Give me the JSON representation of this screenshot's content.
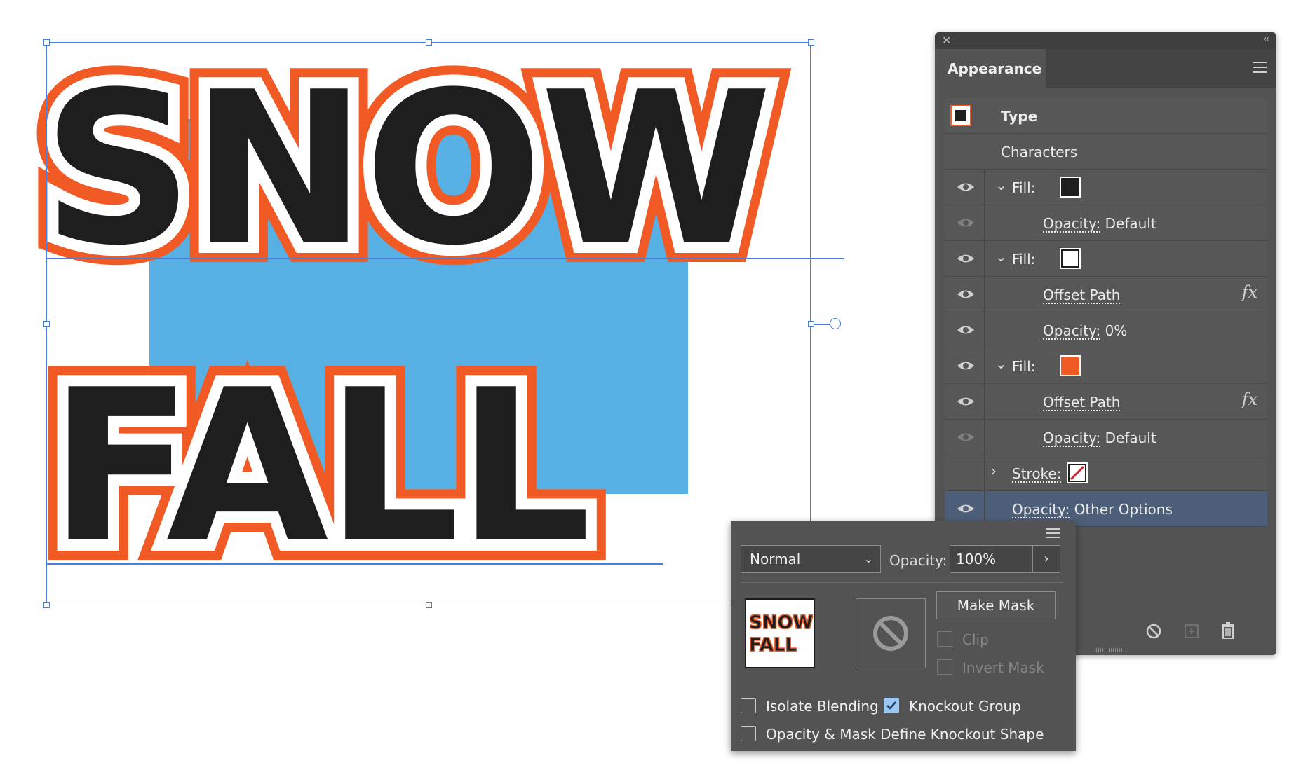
{
  "artwork": {
    "line1": "SNOW",
    "line2": "FALL",
    "colors": {
      "text": "#1e1e1e",
      "outer_stroke": "#f15a25",
      "inner_offset": "#ffffff",
      "background_rect": "#56b0e3",
      "selection": "#4a7fd8"
    }
  },
  "appearance_panel": {
    "tab_title": "Appearance",
    "rows": [
      {
        "label": "Type",
        "kind": "header",
        "swatch": "type"
      },
      {
        "label": "Characters",
        "kind": "plain"
      },
      {
        "label": "Fill:",
        "kind": "fill",
        "expanded": true,
        "swatch_color": "#1e1e1e",
        "eye": true
      },
      {
        "label": "Opacity:",
        "value": "Default",
        "kind": "sub",
        "eye": "dim"
      },
      {
        "label": "Fill:",
        "kind": "fill",
        "expanded": true,
        "swatch_color": "#ffffff",
        "eye": true
      },
      {
        "label": "Offset Path",
        "kind": "effect",
        "eye": true,
        "fx": "fx"
      },
      {
        "label": "Opacity:",
        "value": "0%",
        "kind": "sub",
        "eye": true
      },
      {
        "label": "Fill:",
        "kind": "fill",
        "expanded": true,
        "swatch_color": "#f15a25",
        "eye": true
      },
      {
        "label": "Offset Path",
        "kind": "effect",
        "eye": true,
        "fx": "fx"
      },
      {
        "label": "Opacity:",
        "value": "Default",
        "kind": "sub",
        "eye": "dim"
      },
      {
        "label": "Stroke:",
        "kind": "stroke",
        "expanded": false,
        "swatch": "none"
      },
      {
        "label": "Opacity:",
        "value": "Other Options",
        "kind": "selected",
        "eye": true
      }
    ],
    "footer_icons": [
      "clear-appearance-icon",
      "duplicate-item-icon",
      "delete-item-icon"
    ]
  },
  "transparency_popup": {
    "blend_mode": "Normal",
    "opacity_label": "Opacity:",
    "opacity_value": "100%",
    "thumb_line1": "SNOW",
    "thumb_line2": "FALL",
    "make_mask": "Make Mask",
    "clip": "Clip",
    "invert_mask": "Invert Mask",
    "isolate_blending": "Isolate Blending",
    "knockout_group": "Knockout Group",
    "opacity_mask_knockout": "Opacity & Mask Define Knockout Shape",
    "states": {
      "isolate_blending": false,
      "knockout_group": true,
      "opacity_mask_knockout": false,
      "clip": false,
      "invert_mask": false
    }
  }
}
